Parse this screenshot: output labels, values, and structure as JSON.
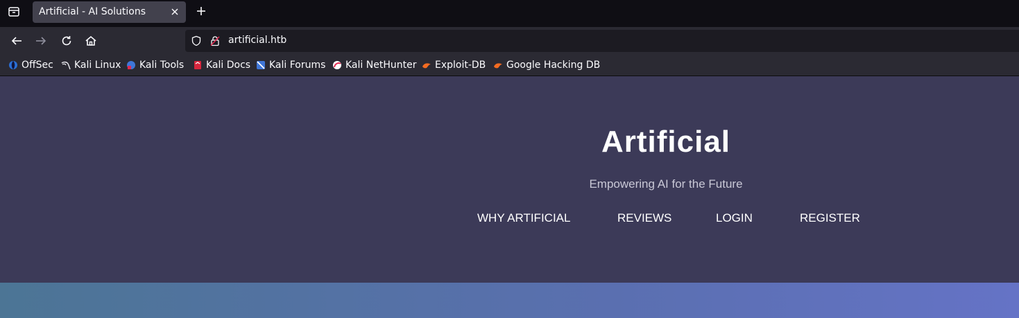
{
  "browser": {
    "tab": {
      "title": "Artificial - AI Solutions"
    },
    "url": "artificial.htb",
    "bookmarks": [
      {
        "label": "OffSec",
        "icon": "offsec-icon"
      },
      {
        "label": "Kali Linux",
        "icon": "kali-dragon-icon"
      },
      {
        "label": "Kali Tools",
        "icon": "kali-tools-icon"
      },
      {
        "label": "Kali Docs",
        "icon": "kali-docs-icon"
      },
      {
        "label": "Kali Forums",
        "icon": "kali-forums-icon"
      },
      {
        "label": "Kali NetHunter",
        "icon": "nethunter-icon"
      },
      {
        "label": "Exploit-DB",
        "icon": "exploit-db-icon"
      },
      {
        "label": "Google Hacking DB",
        "icon": "ghdb-icon"
      }
    ]
  },
  "site": {
    "title": "Artificial",
    "tagline": "Empowering AI for the Future",
    "nav": [
      "WHY ARTIFICIAL",
      "REVIEWS",
      "LOGIN",
      "REGISTER"
    ]
  },
  "colors": {
    "header_bg": "#3c3a58",
    "band_start": "#4c7595",
    "band_end": "#6573c6",
    "tab_bg": "#42414d",
    "toolbar_bg": "#2b2a33"
  }
}
